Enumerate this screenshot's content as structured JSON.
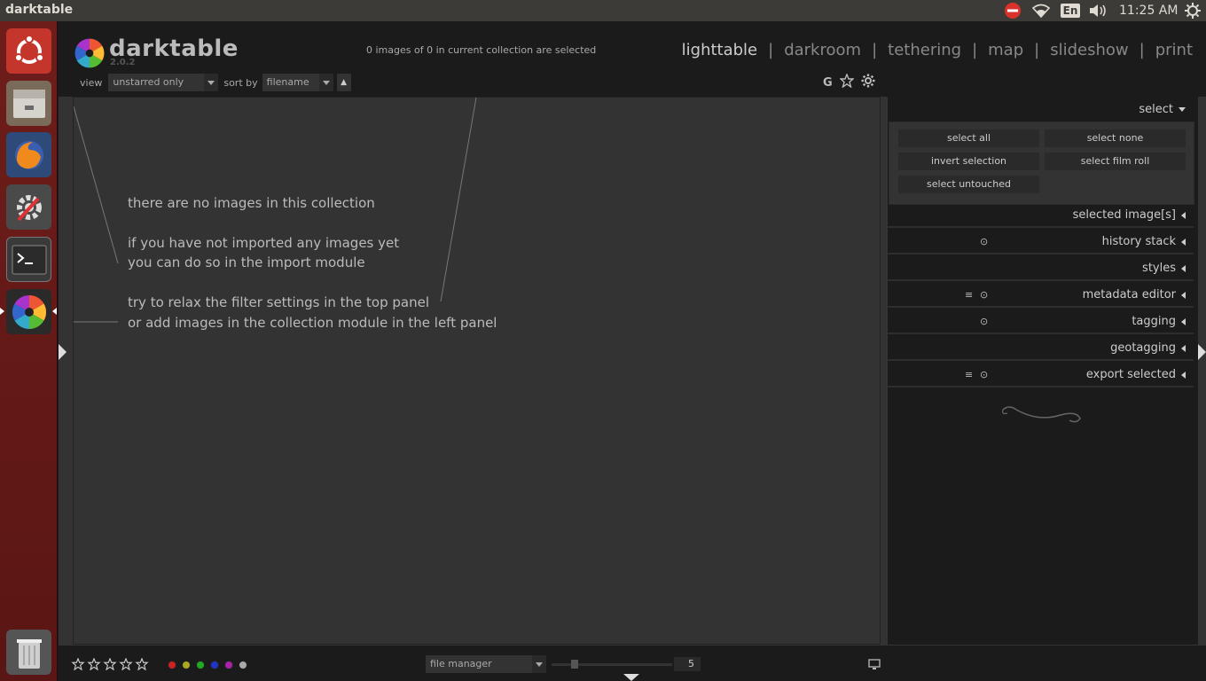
{
  "system": {
    "app_title": "darktable",
    "keyboard_layout": "En",
    "clock": "11:25 AM"
  },
  "launcher": {
    "items": [
      "ubuntu-dash",
      "files",
      "firefox",
      "system-settings",
      "terminal",
      "darktable",
      "trash"
    ],
    "colors": {
      "background": "#6e1d1a"
    }
  },
  "app": {
    "name": "darktable",
    "version": "2.0.2",
    "selection_status": "0 images of 0 in current collection are selected",
    "views": [
      "lighttable",
      "darkroom",
      "tethering",
      "map",
      "slideshow",
      "print"
    ],
    "active_view": "lighttable",
    "separator": "|"
  },
  "filter": {
    "view_label": "view",
    "view_value": "unstarred only",
    "sort_label": "sort by",
    "sort_value": "filename",
    "sort_direction": "▲"
  },
  "header_icons": {
    "grouping": "G"
  },
  "center": {
    "messages": [
      "there are no images in this collection",
      "if you have not imported any images yet",
      "you can do so in the import module",
      "try to relax the filter settings in the top panel",
      "or add images in the collection module in the left panel"
    ]
  },
  "right_panel": {
    "select_title": "select",
    "select_buttons": [
      "select all",
      "select none",
      "invert selection",
      "select film roll",
      "select untouched"
    ],
    "sections": [
      "selected image[s]",
      "history stack",
      "styles",
      "metadata editor",
      "tagging",
      "geotagging",
      "export selected"
    ]
  },
  "bottom": {
    "layout_value": "file manager",
    "zoom_value": "5",
    "color_labels": [
      "#cc2222",
      "#aaaa22",
      "#22aa22",
      "#2233cc",
      "#aa22aa",
      "#aaaaaa"
    ]
  }
}
